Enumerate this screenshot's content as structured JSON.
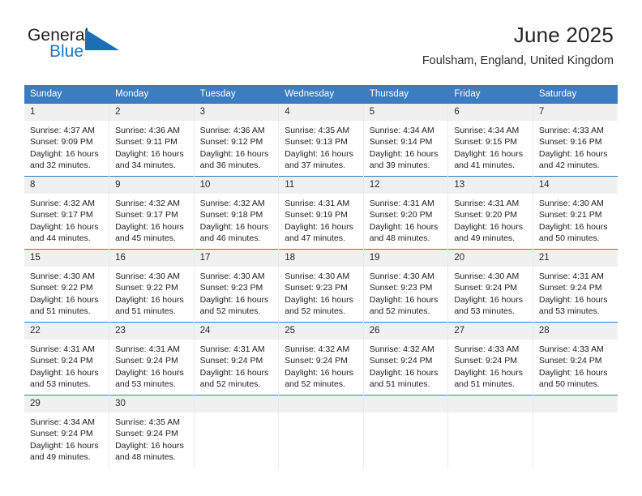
{
  "brand": {
    "name_top": "General",
    "name_bottom": "Blue",
    "triangle_color": "#1b6fb5",
    "blue_text_color": "#1b7ac4"
  },
  "header": {
    "title": "June 2025",
    "subtitle": "Foulsham, England, United Kingdom"
  },
  "theme": {
    "header_row_bg": "#3b7dc0",
    "header_row_text": "#ffffff",
    "daynum_bg": "#f0f0f0",
    "row_rule": "#3b7dc0",
    "cell_divider": "#e9e9ea"
  },
  "weekdays": [
    "Sunday",
    "Monday",
    "Tuesday",
    "Wednesday",
    "Thursday",
    "Friday",
    "Saturday"
  ],
  "weeks": [
    [
      {
        "day": "1",
        "sunrise": "Sunrise: 4:37 AM",
        "sunset": "Sunset: 9:09 PM",
        "daylight1": "Daylight: 16 hours",
        "daylight2": "and 32 minutes."
      },
      {
        "day": "2",
        "sunrise": "Sunrise: 4:36 AM",
        "sunset": "Sunset: 9:11 PM",
        "daylight1": "Daylight: 16 hours",
        "daylight2": "and 34 minutes."
      },
      {
        "day": "3",
        "sunrise": "Sunrise: 4:36 AM",
        "sunset": "Sunset: 9:12 PM",
        "daylight1": "Daylight: 16 hours",
        "daylight2": "and 36 minutes."
      },
      {
        "day": "4",
        "sunrise": "Sunrise: 4:35 AM",
        "sunset": "Sunset: 9:13 PM",
        "daylight1": "Daylight: 16 hours",
        "daylight2": "and 37 minutes."
      },
      {
        "day": "5",
        "sunrise": "Sunrise: 4:34 AM",
        "sunset": "Sunset: 9:14 PM",
        "daylight1": "Daylight: 16 hours",
        "daylight2": "and 39 minutes."
      },
      {
        "day": "6",
        "sunrise": "Sunrise: 4:34 AM",
        "sunset": "Sunset: 9:15 PM",
        "daylight1": "Daylight: 16 hours",
        "daylight2": "and 41 minutes."
      },
      {
        "day": "7",
        "sunrise": "Sunrise: 4:33 AM",
        "sunset": "Sunset: 9:16 PM",
        "daylight1": "Daylight: 16 hours",
        "daylight2": "and 42 minutes."
      }
    ],
    [
      {
        "day": "8",
        "sunrise": "Sunrise: 4:32 AM",
        "sunset": "Sunset: 9:17 PM",
        "daylight1": "Daylight: 16 hours",
        "daylight2": "and 44 minutes."
      },
      {
        "day": "9",
        "sunrise": "Sunrise: 4:32 AM",
        "sunset": "Sunset: 9:17 PM",
        "daylight1": "Daylight: 16 hours",
        "daylight2": "and 45 minutes."
      },
      {
        "day": "10",
        "sunrise": "Sunrise: 4:32 AM",
        "sunset": "Sunset: 9:18 PM",
        "daylight1": "Daylight: 16 hours",
        "daylight2": "and 46 minutes."
      },
      {
        "day": "11",
        "sunrise": "Sunrise: 4:31 AM",
        "sunset": "Sunset: 9:19 PM",
        "daylight1": "Daylight: 16 hours",
        "daylight2": "and 47 minutes."
      },
      {
        "day": "12",
        "sunrise": "Sunrise: 4:31 AM",
        "sunset": "Sunset: 9:20 PM",
        "daylight1": "Daylight: 16 hours",
        "daylight2": "and 48 minutes."
      },
      {
        "day": "13",
        "sunrise": "Sunrise: 4:31 AM",
        "sunset": "Sunset: 9:20 PM",
        "daylight1": "Daylight: 16 hours",
        "daylight2": "and 49 minutes."
      },
      {
        "day": "14",
        "sunrise": "Sunrise: 4:30 AM",
        "sunset": "Sunset: 9:21 PM",
        "daylight1": "Daylight: 16 hours",
        "daylight2": "and 50 minutes."
      }
    ],
    [
      {
        "day": "15",
        "sunrise": "Sunrise: 4:30 AM",
        "sunset": "Sunset: 9:22 PM",
        "daylight1": "Daylight: 16 hours",
        "daylight2": "and 51 minutes."
      },
      {
        "day": "16",
        "sunrise": "Sunrise: 4:30 AM",
        "sunset": "Sunset: 9:22 PM",
        "daylight1": "Daylight: 16 hours",
        "daylight2": "and 51 minutes."
      },
      {
        "day": "17",
        "sunrise": "Sunrise: 4:30 AM",
        "sunset": "Sunset: 9:23 PM",
        "daylight1": "Daylight: 16 hours",
        "daylight2": "and 52 minutes."
      },
      {
        "day": "18",
        "sunrise": "Sunrise: 4:30 AM",
        "sunset": "Sunset: 9:23 PM",
        "daylight1": "Daylight: 16 hours",
        "daylight2": "and 52 minutes."
      },
      {
        "day": "19",
        "sunrise": "Sunrise: 4:30 AM",
        "sunset": "Sunset: 9:23 PM",
        "daylight1": "Daylight: 16 hours",
        "daylight2": "and 52 minutes."
      },
      {
        "day": "20",
        "sunrise": "Sunrise: 4:30 AM",
        "sunset": "Sunset: 9:24 PM",
        "daylight1": "Daylight: 16 hours",
        "daylight2": "and 53 minutes."
      },
      {
        "day": "21",
        "sunrise": "Sunrise: 4:31 AM",
        "sunset": "Sunset: 9:24 PM",
        "daylight1": "Daylight: 16 hours",
        "daylight2": "and 53 minutes."
      }
    ],
    [
      {
        "day": "22",
        "sunrise": "Sunrise: 4:31 AM",
        "sunset": "Sunset: 9:24 PM",
        "daylight1": "Daylight: 16 hours",
        "daylight2": "and 53 minutes."
      },
      {
        "day": "23",
        "sunrise": "Sunrise: 4:31 AM",
        "sunset": "Sunset: 9:24 PM",
        "daylight1": "Daylight: 16 hours",
        "daylight2": "and 53 minutes."
      },
      {
        "day": "24",
        "sunrise": "Sunrise: 4:31 AM",
        "sunset": "Sunset: 9:24 PM",
        "daylight1": "Daylight: 16 hours",
        "daylight2": "and 52 minutes."
      },
      {
        "day": "25",
        "sunrise": "Sunrise: 4:32 AM",
        "sunset": "Sunset: 9:24 PM",
        "daylight1": "Daylight: 16 hours",
        "daylight2": "and 52 minutes."
      },
      {
        "day": "26",
        "sunrise": "Sunrise: 4:32 AM",
        "sunset": "Sunset: 9:24 PM",
        "daylight1": "Daylight: 16 hours",
        "daylight2": "and 51 minutes."
      },
      {
        "day": "27",
        "sunrise": "Sunrise: 4:33 AM",
        "sunset": "Sunset: 9:24 PM",
        "daylight1": "Daylight: 16 hours",
        "daylight2": "and 51 minutes."
      },
      {
        "day": "28",
        "sunrise": "Sunrise: 4:33 AM",
        "sunset": "Sunset: 9:24 PM",
        "daylight1": "Daylight: 16 hours",
        "daylight2": "and 50 minutes."
      }
    ],
    [
      {
        "day": "29",
        "sunrise": "Sunrise: 4:34 AM",
        "sunset": "Sunset: 9:24 PM",
        "daylight1": "Daylight: 16 hours",
        "daylight2": "and 49 minutes."
      },
      {
        "day": "30",
        "sunrise": "Sunrise: 4:35 AM",
        "sunset": "Sunset: 9:24 PM",
        "daylight1": "Daylight: 16 hours",
        "daylight2": "and 48 minutes."
      },
      {
        "day": "",
        "sunrise": "",
        "sunset": "",
        "daylight1": "",
        "daylight2": ""
      },
      {
        "day": "",
        "sunrise": "",
        "sunset": "",
        "daylight1": "",
        "daylight2": ""
      },
      {
        "day": "",
        "sunrise": "",
        "sunset": "",
        "daylight1": "",
        "daylight2": ""
      },
      {
        "day": "",
        "sunrise": "",
        "sunset": "",
        "daylight1": "",
        "daylight2": ""
      },
      {
        "day": "",
        "sunrise": "",
        "sunset": "",
        "daylight1": "",
        "daylight2": ""
      }
    ]
  ]
}
